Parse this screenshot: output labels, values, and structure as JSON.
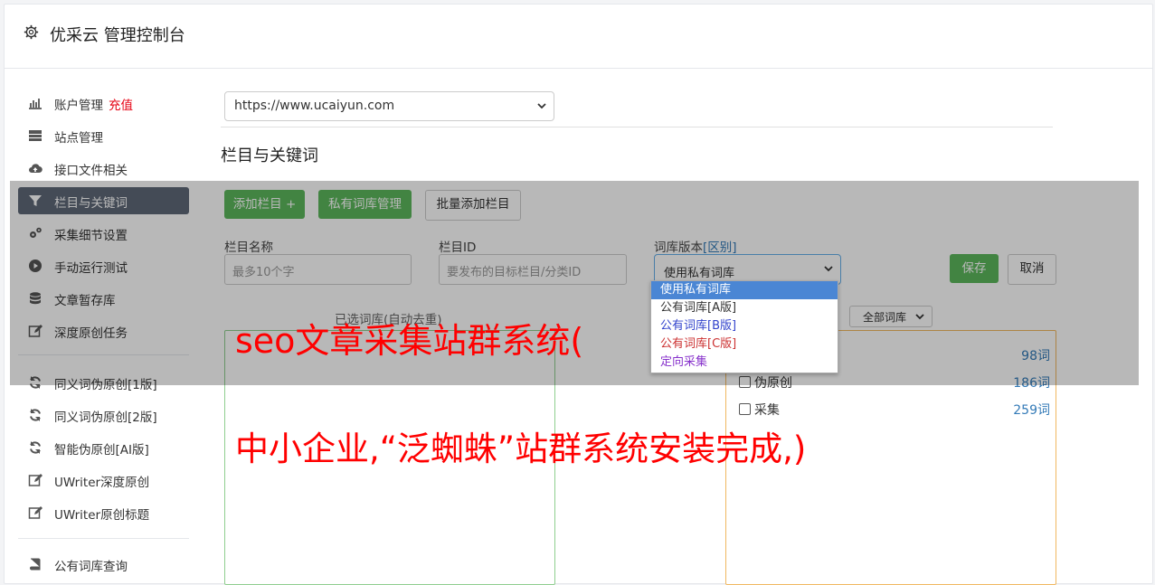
{
  "app": {
    "title": "优采云 管理控制台"
  },
  "sidebar": {
    "items": [
      {
        "label": "账户管理",
        "badge": "充值",
        "icon": "bar-chart-icon"
      },
      {
        "label": "站点管理",
        "icon": "server-icon"
      },
      {
        "label": "接口文件相关",
        "icon": "cloud-upload-icon"
      },
      {
        "label": "栏目与关键词",
        "icon": "filter-icon",
        "active": true
      },
      {
        "label": "采集细节设置",
        "icon": "gears-icon"
      },
      {
        "label": "手动运行测试",
        "icon": "play-circle-icon"
      },
      {
        "label": "文章暂存库",
        "icon": "database-icon"
      },
      {
        "label": "深度原创任务",
        "icon": "edit-icon"
      },
      {
        "label": "同义词伪原创[1版]",
        "icon": "refresh-icon"
      },
      {
        "label": "同义词伪原创[2版]",
        "icon": "refresh-icon"
      },
      {
        "label": "智能伪原创[AI版]",
        "icon": "refresh-icon"
      },
      {
        "label": "UWriter深度原创",
        "icon": "edit-icon"
      },
      {
        "label": "UWriter原创标题",
        "icon": "edit-icon"
      },
      {
        "label": "公有词库查询",
        "icon": "book-icon"
      }
    ]
  },
  "site_select": {
    "value": "https://www.ucaiyun.com"
  },
  "section": {
    "title": "栏目与关键词"
  },
  "toolbar": {
    "add_column": "添加栏目 +",
    "private_lexicon": "私有词库管理",
    "batch_add": "批量添加栏目"
  },
  "form": {
    "column_name_label": "栏目名称",
    "column_name_placeholder": "最多10个字",
    "column_id_label": "栏目ID",
    "column_id_placeholder": "要发布的目标栏目/分类ID",
    "lexicon_version_label": "词库版本",
    "lexicon_version_link": "[区别]",
    "lexicon_version_value": "使用私有词库",
    "save": "保存",
    "cancel": "取消"
  },
  "dropdown": {
    "options": [
      "使用私有词库",
      "公有词库[A版]",
      "公有词库[B版]",
      "公有词库[C版]",
      "定向采集"
    ],
    "option_colors": [
      "#ffffff",
      "#333333",
      "#3344cc",
      "#cc3333",
      "#8833cc"
    ]
  },
  "selected_lexicon": {
    "label": "已选词库(自动去重)"
  },
  "wordlib_filter": {
    "value": "全部词库"
  },
  "wordlib_list": [
    {
      "name": "",
      "count": "98词"
    },
    {
      "name": "伪原创",
      "count": "186词"
    },
    {
      "name": "采集",
      "count": "259词"
    }
  ],
  "overlay_text": {
    "line1": "seo文章采集站群系统(",
    "line2": "中小企业,“泛蜘蛛”站群系统安装完成,)"
  },
  "colors": {
    "active_nav": "#5f6878",
    "green": "#5cb85c",
    "link": "#337ab7",
    "red_badge": "#e60012"
  }
}
